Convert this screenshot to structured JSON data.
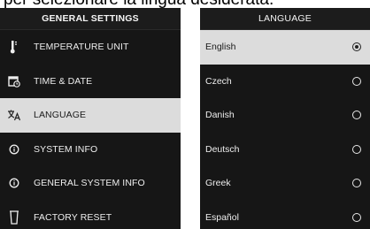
{
  "caption": "per selezionare la lingua desiderata.",
  "settings": {
    "title": "GENERAL SETTINGS",
    "items": [
      {
        "label": "TEMPERATURE UNIT",
        "icon": "thermometer-icon"
      },
      {
        "label": "TIME & DATE",
        "icon": "calendar-clock-icon"
      },
      {
        "label": "LANGUAGE",
        "icon": "translate-icon",
        "selected": true
      },
      {
        "label": "SYSTEM INFO",
        "icon": "info-icon"
      },
      {
        "label": "GENERAL SYSTEM INFO",
        "icon": "info-icon"
      },
      {
        "label": "FACTORY RESET",
        "icon": "trash-icon"
      }
    ]
  },
  "language": {
    "title": "LANGUAGE",
    "options": [
      {
        "label": "English",
        "selected": true
      },
      {
        "label": "Czech"
      },
      {
        "label": "Danish"
      },
      {
        "label": "Deutsch"
      },
      {
        "label": "Greek"
      },
      {
        "label": "Español"
      }
    ]
  }
}
